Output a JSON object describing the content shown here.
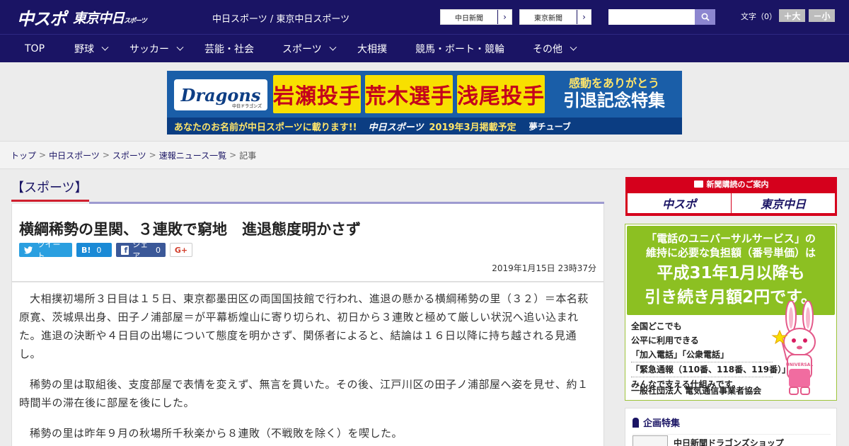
{
  "header": {
    "logo_main": "中スポ",
    "logo_sub": "東京中日",
    "logo_sub_small": "スポーツ",
    "site_title": "中日スポーツ / 東京中日スポーツ",
    "ext_links": [
      {
        "label": "中日新聞",
        "arrow": "›"
      },
      {
        "label": "東京新聞",
        "arrow": "›"
      }
    ],
    "search_placeholder": "",
    "font_size_label": "文字（0）",
    "font_larger": "＋大",
    "font_smaller": "－小"
  },
  "nav": [
    {
      "label": "TOP",
      "dropdown": false
    },
    {
      "label": "野球",
      "dropdown": true
    },
    {
      "label": "サッカー",
      "dropdown": true
    },
    {
      "label": "芸能・社会",
      "dropdown": false
    },
    {
      "label": "スポーツ",
      "dropdown": true
    },
    {
      "label": "大相撲",
      "dropdown": false
    },
    {
      "label": "競馬・ボート・競輪",
      "dropdown": false
    },
    {
      "label": "その他",
      "dropdown": true
    }
  ],
  "banner": {
    "logo": "Dragons",
    "logo_small": "中日ドラゴンズ",
    "names": [
      "岩瀬投手",
      "荒木選手",
      "浅尾投手"
    ],
    "thanks": "感動をありがとう",
    "thanks_big": "引退記念特集",
    "bottom_text": "あなたのお名前が中日スポーツに載ります!!",
    "bottom_logo": "中日スポーツ",
    "bottom_date": "2019年3月掲載予定",
    "bottom_fund": "夢チューブ"
  },
  "breadcrumb": {
    "items": [
      "トップ",
      "中日スポーツ",
      "スポーツ",
      "速報ニュース一覧"
    ],
    "current": "記事",
    "separator": ">"
  },
  "article": {
    "section": "【スポーツ】",
    "title": "横綱稀勢の里関、３連敗で窮地　進退態度明かさず",
    "share": {
      "tweet": "ツイート",
      "hatena": "B!",
      "hatena_count": "0",
      "facebook": "シェア",
      "facebook_count": "0",
      "gplus": "G+"
    },
    "date": "2019年1月15日 23時37分",
    "paragraphs": [
      "大相撲初場所３日目は１５日、東京都墨田区の両国国技館で行われ、進退の懸かる横綱稀勢の里（３２）＝本名萩原寛、茨城県出身、田子ノ浦部屋＝が平幕栃煌山に寄り切られ、初日から３連敗と極めて厳しい状況へ追い込まれた。進退の決断や４日目の出場について態度を明かさず、関係者によると、結論は１６日以降に持ち越される見通し。",
      "稀勢の里は取組後、支度部屋で表情を変えず、無言を貫いた。その後、江戸川区の田子ノ浦部屋へ姿を見せ、約１時間半の滞在後に部屋を後にした。",
      "稀勢の里は昨年９月の秋場所千秋楽から８連敗（不戦敗を除く）を喫した。"
    ]
  },
  "sidebar": {
    "subscribe_title": "新聞購読のご案内",
    "subscribe_logos": [
      "中スポ",
      "東京中日"
    ],
    "ad": {
      "line1": "「電話のユニバーサルサービス」の",
      "line2": "維持に必要な負担額（番号単価）は",
      "line3": "平成31年1月以降も",
      "line4": "引き続き月額2円です。",
      "body1": "全国どこでも",
      "body2": "公平に利用できる",
      "body3": "「加入電話」「公衆電話」",
      "body4": "「緊急通報（110番、118番、119番）」を",
      "body5": "みんなで支える仕組みです。",
      "org": "一般社団法人 電気通信事業者協会"
    },
    "feature_title": "企画特集",
    "feature_item": "中日新聞ドラゴンズショップ"
  },
  "colors": {
    "header_bg": "#1a1464",
    "accent_red": "#d01f2e",
    "ad_green": "#8cc022"
  }
}
